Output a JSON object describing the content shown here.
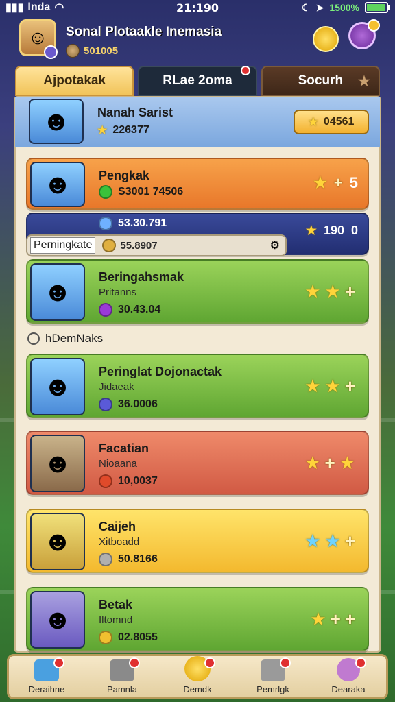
{
  "status": {
    "carrier": "lnda",
    "time": "21:190",
    "battery": "1500%",
    "battery_level": 1.0
  },
  "header": {
    "player_name": "Sonal Plotaakle Inemasia",
    "coins": "501005"
  },
  "tabs": [
    {
      "label": "Ajpotakak",
      "active": true
    },
    {
      "label": "RLae 2oma",
      "badge": true
    },
    {
      "label": "Socurh"
    }
  ],
  "top_row": {
    "name": "Nanah Sarist",
    "score": "226377",
    "pill_value": "04561"
  },
  "rows": [
    {
      "name": "Pengkak",
      "value": "S3001 74506",
      "right": "5"
    },
    {
      "name": "Beringahsmak",
      "sub": "Pritanns",
      "value": "30.43.04"
    },
    {
      "name": "Peringlat Dojonactak",
      "sub": "Jidaeak",
      "value": "36.0006"
    },
    {
      "name": "Facatian",
      "sub": "Nioaana",
      "value": "10,0037"
    },
    {
      "name": "Caijeh",
      "sub": "Xitboadd",
      "value": "50.8166"
    },
    {
      "name": "Betak",
      "sub": "Iltomnd",
      "value": "02.8055"
    }
  ],
  "navy_row": {
    "value": "53.30.791",
    "right": "190"
  },
  "navy_row_right_zero": "0",
  "tag_bar": {
    "label": "Perningkate",
    "value": "55.8907"
  },
  "section": {
    "label": "hDemNaks"
  },
  "nav": [
    {
      "label": "Deraihne",
      "icon": "home-icon"
    },
    {
      "label": "Pamnla",
      "icon": "hammer-icon"
    },
    {
      "label": "Demdk",
      "icon": "gold-coin-icon"
    },
    {
      "label": "Pemrlgk",
      "icon": "chest-icon"
    },
    {
      "label": "Dearaka",
      "icon": "ball-icon"
    }
  ],
  "colors": {
    "accent": "#f1c45a",
    "panel": "#f3ead6",
    "green": "#5fa632",
    "orange": "#e8772a",
    "navy": "#222e72"
  }
}
